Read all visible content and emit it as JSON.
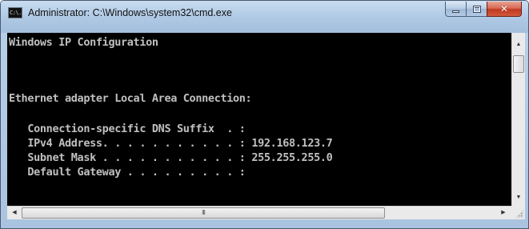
{
  "window": {
    "title": "Administrator: C:\\Windows\\system32\\cmd.exe",
    "icon_text": "C:\\."
  },
  "controls": {
    "minimize_icon": "minimize-icon",
    "maximize_icon": "maximize-icon",
    "close_icon": "close-icon",
    "close_glyph": "✕"
  },
  "console": {
    "text_color": "#c0c0c0",
    "background": "#000000",
    "lines": [
      "Windows IP Configuration",
      "",
      "",
      "Ethernet adapter Local Area Connection:",
      "",
      "   Connection-specific DNS Suffix  . :",
      "   IPv4 Address. . . . . . . . . . . : 192.168.123.7",
      "   Subnet Mask . . . . . . . . . . . : 255.255.255.0",
      "   Default Gateway . . . . . . . . . :"
    ]
  },
  "scrollbars": {
    "up_arrow": "▲",
    "down_arrow": "▼",
    "left_arrow": "◀",
    "right_arrow": "▶",
    "thumb_grip": "III"
  }
}
